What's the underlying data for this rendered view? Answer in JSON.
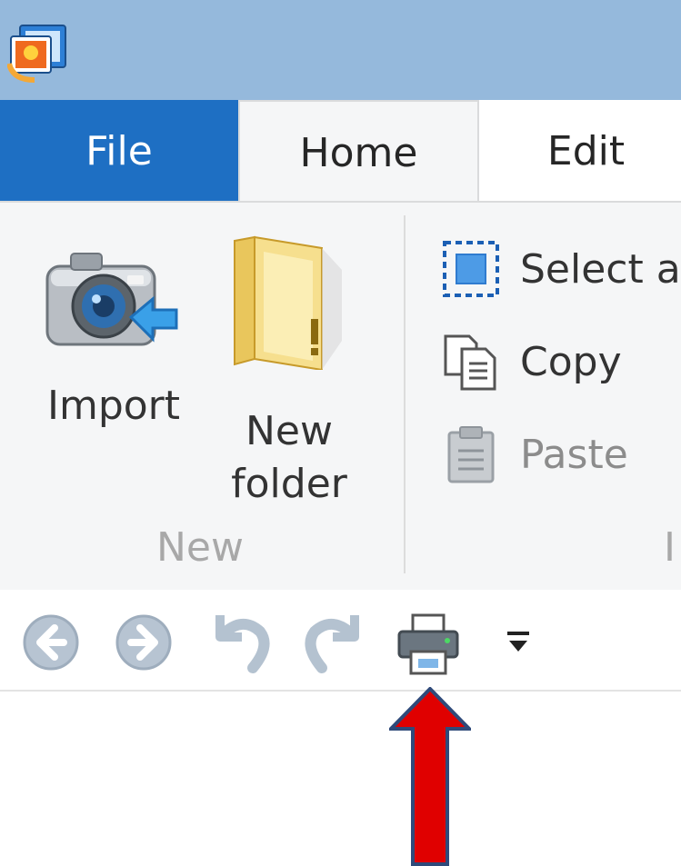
{
  "window": {
    "app_icon": "photo-gallery-app-icon"
  },
  "tabs": [
    {
      "label": "File",
      "active": false
    },
    {
      "label": "Home",
      "active": true
    },
    {
      "label": "Edit",
      "active": false
    }
  ],
  "ribbon": {
    "new_group": {
      "import_label": "Import",
      "new_folder_label_line1": "New",
      "new_folder_label_line2": "folder",
      "group_label": "New"
    },
    "clipboard": {
      "select_all_label": "Select a",
      "copy_label": "Copy",
      "paste_label": "Paste",
      "group_label_partial": "I"
    }
  },
  "quick_access": {
    "icons": [
      "back-icon",
      "forward-icon",
      "undo-icon",
      "redo-icon",
      "print-icon",
      "customize-dropdown-icon"
    ]
  },
  "annotation": {
    "arrow_color": "#e00000",
    "arrow_outline": "#2f4a7a"
  },
  "colors": {
    "titlebar": "#95b9dc",
    "file_tab": "#1e6fc3",
    "ribbon_bg": "#f5f6f7"
  }
}
